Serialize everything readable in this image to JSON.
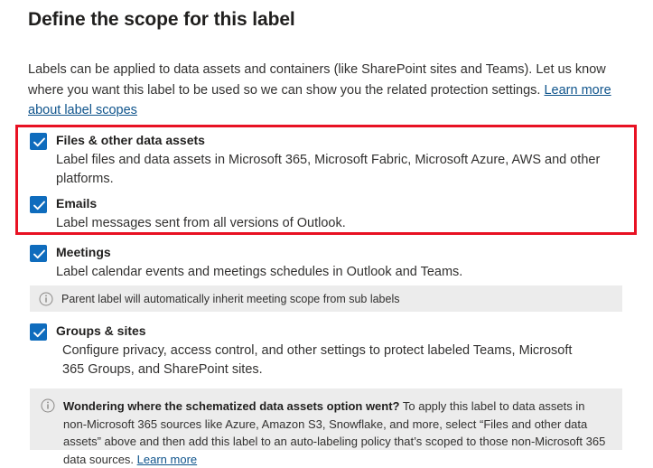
{
  "page": {
    "title": "Define the scope for this label",
    "intro_text": "Labels can be applied to data assets and containers (like SharePoint sites and Teams). Let us know where you want this label to be used so we can show you the related protection settings. ",
    "intro_link": "Learn more about label scopes"
  },
  "options": [
    {
      "name": "files-other-data-assets",
      "label": "Files & other data assets",
      "description": "Label files and data assets in Microsoft 365, Microsoft Fabric, Microsoft Azure, AWS and other platforms.",
      "checked": true
    },
    {
      "name": "emails",
      "label": "Emails",
      "description": "Label messages sent from all versions of Outlook.",
      "checked": true
    },
    {
      "name": "meetings",
      "label": "Meetings",
      "description": "Label calendar events and meetings schedules in Outlook and Teams.",
      "checked": true
    },
    {
      "name": "groups-sites",
      "label": "Groups & sites",
      "description": "Configure privacy, access control, and other settings to protect labeled Teams, Microsoft 365 Groups, and SharePoint sites.",
      "checked": true
    }
  ],
  "info_meetings": {
    "icon": "info-icon",
    "text": "Parent label will automatically inherit meeting scope from sub labels"
  },
  "info_schematized": {
    "icon": "info-icon",
    "bold_lead": "Wondering where the schematized data assets option went?",
    "text": " To apply this label to data assets in non-Microsoft 365 sources like Azure, Amazon S3, Snowflake, and more, select “Files and other data assets” above and then add this label to an auto-labeling policy that’s scoped to those non-Microsoft 365 data sources. ",
    "link": "Learn more"
  },
  "colors": {
    "checkbox_blue": "#0f6cbd",
    "highlight_red": "#e81123",
    "link_blue": "#0f548c",
    "infobar_gray": "#ececec",
    "text": "#323130"
  }
}
